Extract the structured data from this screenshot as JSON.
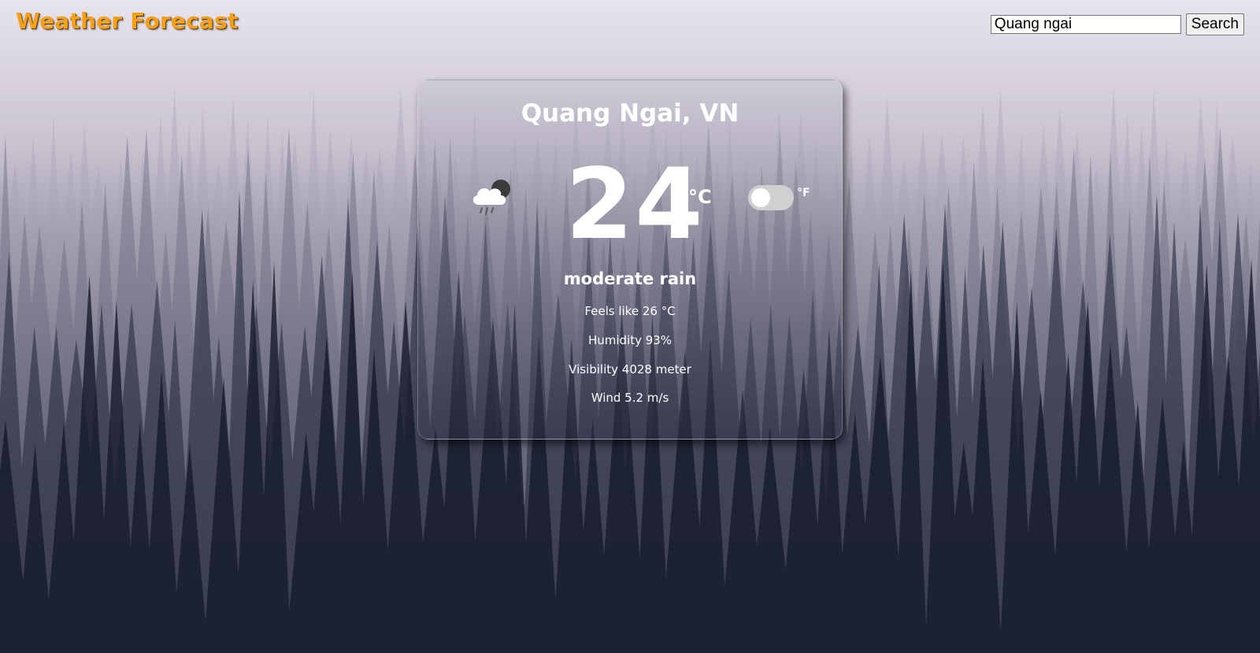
{
  "header": {
    "brand": "Weather Forecast"
  },
  "search": {
    "value": "Quang ngai",
    "button_label": "Search"
  },
  "card": {
    "location": "Quang Ngai, VN",
    "weather_icon": "rain-cloud-night-icon",
    "temperature": "24",
    "unit_celsius": "°C",
    "unit_fahrenheit": "°F",
    "unit_toggle_on": false,
    "description": "moderate rain",
    "details": {
      "feels_like": "Feels like 26 °C",
      "humidity": "Humidity 93%",
      "visibility": "Visibility 4028 meter",
      "wind": "Wind 5.2 m/s"
    }
  },
  "colors": {
    "brand": "#f5a01b",
    "toggle_track": "#d0d0d0"
  }
}
